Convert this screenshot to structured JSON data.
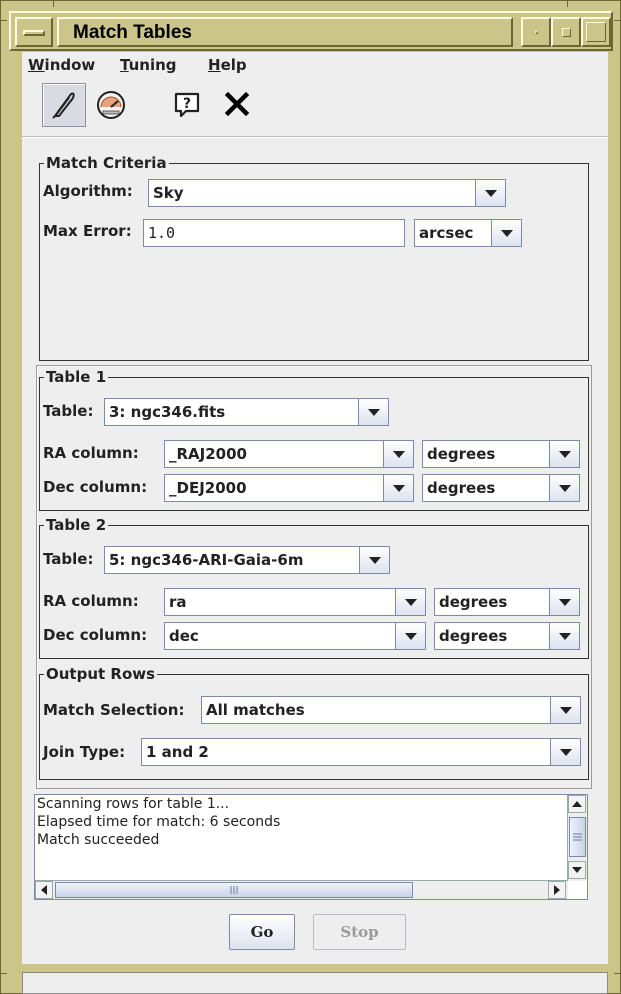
{
  "window": {
    "title": "Match Tables"
  },
  "menu": {
    "window_label": "Window",
    "window_mnemonic": "W",
    "window_rest": "indow",
    "tuning_mnemonic": "T",
    "tuning_rest": "uning",
    "help_mnemonic": "H",
    "help_rest": "elp"
  },
  "toolbar": {
    "icons": [
      "feather-icon",
      "gauge-icon",
      "help-icon",
      "close-icon"
    ]
  },
  "match_criteria": {
    "title": "Match Criteria",
    "algorithm_label": "Algorithm:",
    "algorithm_value": "Sky",
    "max_error_label": "Max Error:",
    "max_error_value": "1.0",
    "max_error_unit": "arcsec"
  },
  "table1": {
    "title": "Table 1",
    "table_label": "Table:",
    "table_value": "3: ngc346.fits",
    "ra_label": "RA column:",
    "ra_value": "_RAJ2000",
    "ra_unit": "degrees",
    "dec_label": "Dec column:",
    "dec_value": "_DEJ2000",
    "dec_unit": "degrees"
  },
  "table2": {
    "title": "Table 2",
    "table_label": "Table:",
    "table_value": "5: ngc346-ARI-Gaia-6m",
    "ra_label": "RA column:",
    "ra_value": "ra",
    "ra_unit": "degrees",
    "dec_label": "Dec column:",
    "dec_value": "dec",
    "dec_unit": "degrees"
  },
  "output_rows": {
    "title": "Output Rows",
    "selection_label": "Match Selection:",
    "selection_value": "All matches",
    "join_label": "Join Type:",
    "join_value": "1 and 2"
  },
  "log": {
    "lines": [
      "Scanning rows for table 1...",
      "Elapsed time for match: 6 seconds",
      "Match succeeded"
    ]
  },
  "actions": {
    "go_label": "Go",
    "stop_label": "Stop"
  },
  "colors": {
    "frame": "#cbc58a",
    "panel": "#eeeeee",
    "field_border": "#7a8aa8"
  }
}
